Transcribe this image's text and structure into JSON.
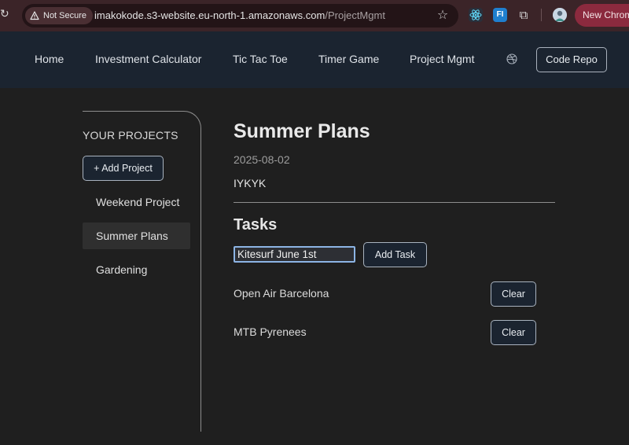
{
  "browser": {
    "security_label": "Not Secure",
    "url_host": "imakokode.s3-website.eu-north-1.amazonaws.com",
    "url_path": "/ProjectMgmt",
    "fi_label": "FI",
    "new_chrome_label": "New Chrom",
    "icons": [
      "reload-icon",
      "warning-icon",
      "star-icon",
      "react-devtools-icon",
      "fi-extension-icon",
      "puzzle-icon",
      "avatar"
    ]
  },
  "nav": {
    "links": [
      "Home",
      "Investment Calculator",
      "Tic Tac Toe",
      "Timer Game",
      "Project Mgmt"
    ],
    "icon": "dribbble-icon",
    "code_repo_label": "Code Repo"
  },
  "sidebar": {
    "title": "YOUR PROJECTS",
    "add_label": "+ Add Project",
    "projects": [
      {
        "label": "Weekend Project",
        "active": false
      },
      {
        "label": "Summer Plans",
        "active": true
      },
      {
        "label": "Gardening",
        "active": false
      }
    ]
  },
  "project": {
    "title": "Summer Plans",
    "date": "2025-08-02",
    "description": "IYKYK"
  },
  "tasks": {
    "title": "Tasks",
    "input_value": "Kitesurf June 1st",
    "add_label": "Add Task",
    "items": [
      {
        "name": "Open Air Barcelona",
        "clear_label": "Clear"
      },
      {
        "name": "MTB Pyrenees",
        "clear_label": "Clear"
      }
    ]
  },
  "colors": {
    "background": "#1f1f1f",
    "nav_background": "#1b2430",
    "chrome_background": "#3b2428",
    "accent_focus": "#8cb4e4"
  }
}
